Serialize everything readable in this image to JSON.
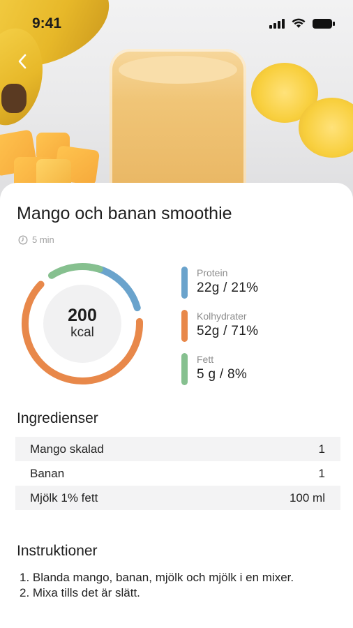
{
  "status_bar": {
    "time": "9:41"
  },
  "recipe": {
    "title": "Mango och banan smoothie",
    "duration": "5 min"
  },
  "nutrition": {
    "kcal_value": "200",
    "kcal_unit": "kcal",
    "macros": [
      {
        "label": "Protein",
        "value": "22g / 21%",
        "color": "#6aa3cc",
        "percent": 21
      },
      {
        "label": "Kolhydrater",
        "value": "52g / 71%",
        "color": "#e8884a",
        "percent": 71
      },
      {
        "label": "Fett",
        "value": "5 g / 8%",
        "color": "#86c08f",
        "percent": 8
      }
    ]
  },
  "ingredients": {
    "title": "Ingredienser",
    "items": [
      {
        "name": "Mango skalad",
        "amount": "1"
      },
      {
        "name": "Banan",
        "amount": "1"
      },
      {
        "name": "Mjölk 1% fett",
        "amount": "100 ml"
      }
    ]
  },
  "instructions": {
    "title": "Instruktioner",
    "steps": [
      "1. Blanda mango, banan, mjölk och mjölk i en mixer.",
      "2. Mixa tills det är slätt."
    ]
  },
  "icons": {
    "back": "chevron-left-icon",
    "clock": "clock-icon",
    "signal": "cellular-signal-icon",
    "wifi": "wifi-icon",
    "battery": "battery-icon"
  }
}
